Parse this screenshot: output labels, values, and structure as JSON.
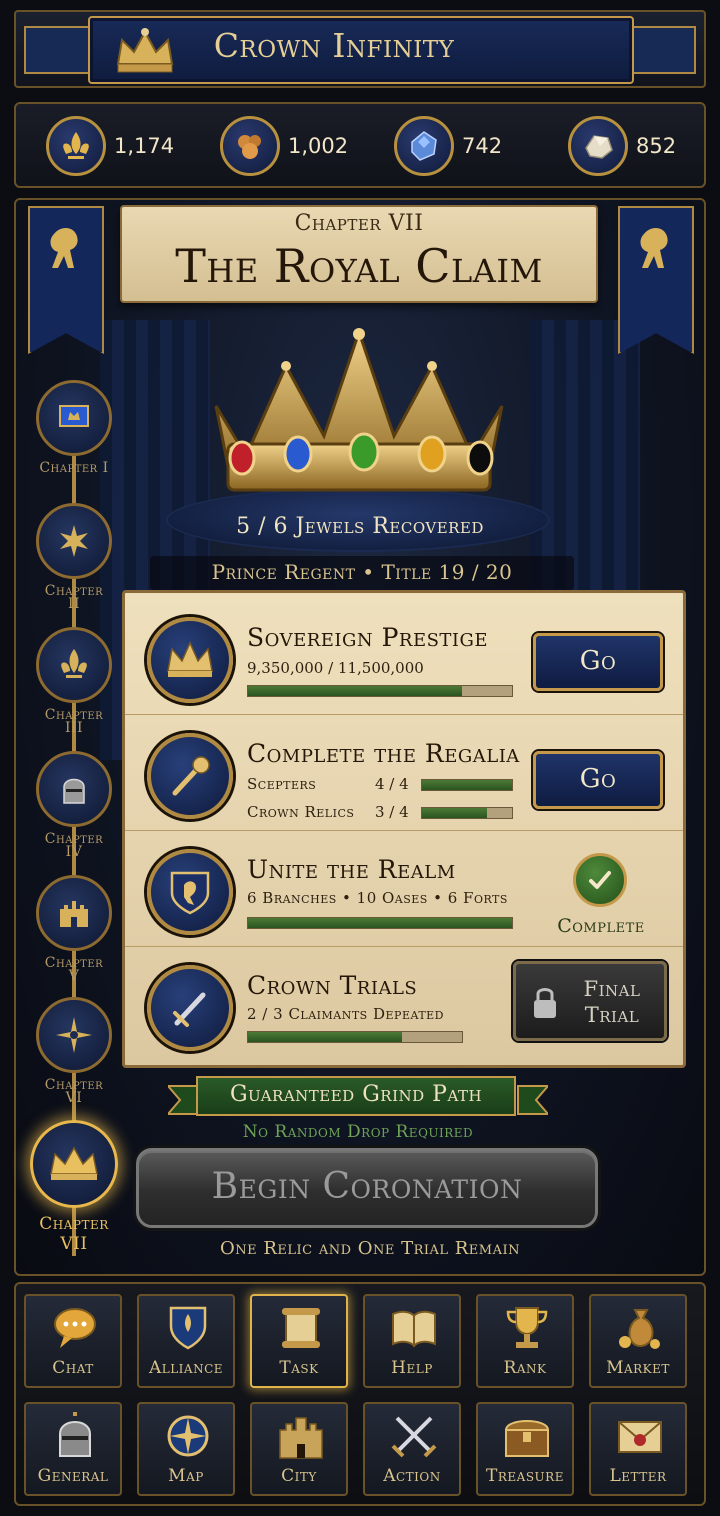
{
  "app": {
    "title": "Crown Infinity"
  },
  "resources": [
    {
      "icon": "fleur-de-lis-icon",
      "value": "1,174"
    },
    {
      "icon": "ore-icon",
      "value": "1,002"
    },
    {
      "icon": "sapphire-icon",
      "value": "742"
    },
    {
      "icon": "stone-icon",
      "value": "852"
    }
  ],
  "chapter": {
    "label": "Chapter VII",
    "title": "The Royal Claim",
    "jewels": "5 / 6 Jewels Recovered",
    "rank": "Prince Regent • Title 19 / 20"
  },
  "chapters": [
    {
      "label_1": "Chapter I",
      "label_2": "",
      "icon": "banner-flag-icon"
    },
    {
      "label_1": "Chapter",
      "label_2": "II",
      "icon": "sunburst-icon"
    },
    {
      "label_1": "Chapter",
      "label_2": "III",
      "icon": "fleur-de-lis-icon"
    },
    {
      "label_1": "Chapter",
      "label_2": "IV",
      "icon": "knight-helmet-icon"
    },
    {
      "label_1": "Chapter",
      "label_2": "V",
      "icon": "castle-icon"
    },
    {
      "label_1": "Chapter",
      "label_2": "VI",
      "icon": "compass-rose-icon"
    },
    {
      "label_1": "Chapter",
      "label_2": "VII",
      "icon": "crown-icon"
    }
  ],
  "tasks": {
    "prestige": {
      "title": "Sovereign Prestige",
      "progress": "9,350,000 / 11,500,000",
      "fraction": 0.81,
      "button": "Go"
    },
    "regalia": {
      "title": "Complete the Regalia",
      "rows": [
        {
          "label": "Scepters",
          "value": "4 / 4",
          "fraction": 1.0
        },
        {
          "label": "Crown Relics",
          "value": "3 / 4",
          "fraction": 0.72
        }
      ],
      "button": "Go"
    },
    "realm": {
      "title": "Unite the Realm",
      "detail": "6 Branches • 10 Oases • 6 Forts",
      "fraction": 1.0,
      "status": "Complete"
    },
    "trials": {
      "title": "Crown Trials",
      "detail": "2 / 3 Claimants Depeated",
      "fraction": 0.72,
      "button_line1": "Final",
      "button_line2": "Trial"
    }
  },
  "grind": {
    "title": "Guaranteed Grind Path",
    "subtitle": "No Random Drop Required"
  },
  "begin_button": "Begin Coronation",
  "remaining": "One Relic and One Trial Remain",
  "nav": [
    {
      "label": "Chat",
      "icon": "chat-bubble-icon"
    },
    {
      "label": "Alliance",
      "icon": "shield-icon"
    },
    {
      "label": "Task",
      "icon": "scroll-icon"
    },
    {
      "label": "Help",
      "icon": "book-icon"
    },
    {
      "label": "Rank",
      "icon": "trophy-icon"
    },
    {
      "label": "Market",
      "icon": "coin-bag-icon"
    },
    {
      "label": "General",
      "icon": "helmet-icon"
    },
    {
      "label": "Map",
      "icon": "compass-icon"
    },
    {
      "label": "City",
      "icon": "castle-icon"
    },
    {
      "label": "Action",
      "icon": "crossed-swords-icon"
    },
    {
      "label": "Treasure",
      "icon": "chest-icon"
    },
    {
      "label": "Letter",
      "icon": "envelope-icon"
    }
  ],
  "colors": {
    "gold": "#c49a4a",
    "royal_blue": "#172a55",
    "parchment": "#e9d8b2",
    "progress_green": "#3a6a2a"
  }
}
